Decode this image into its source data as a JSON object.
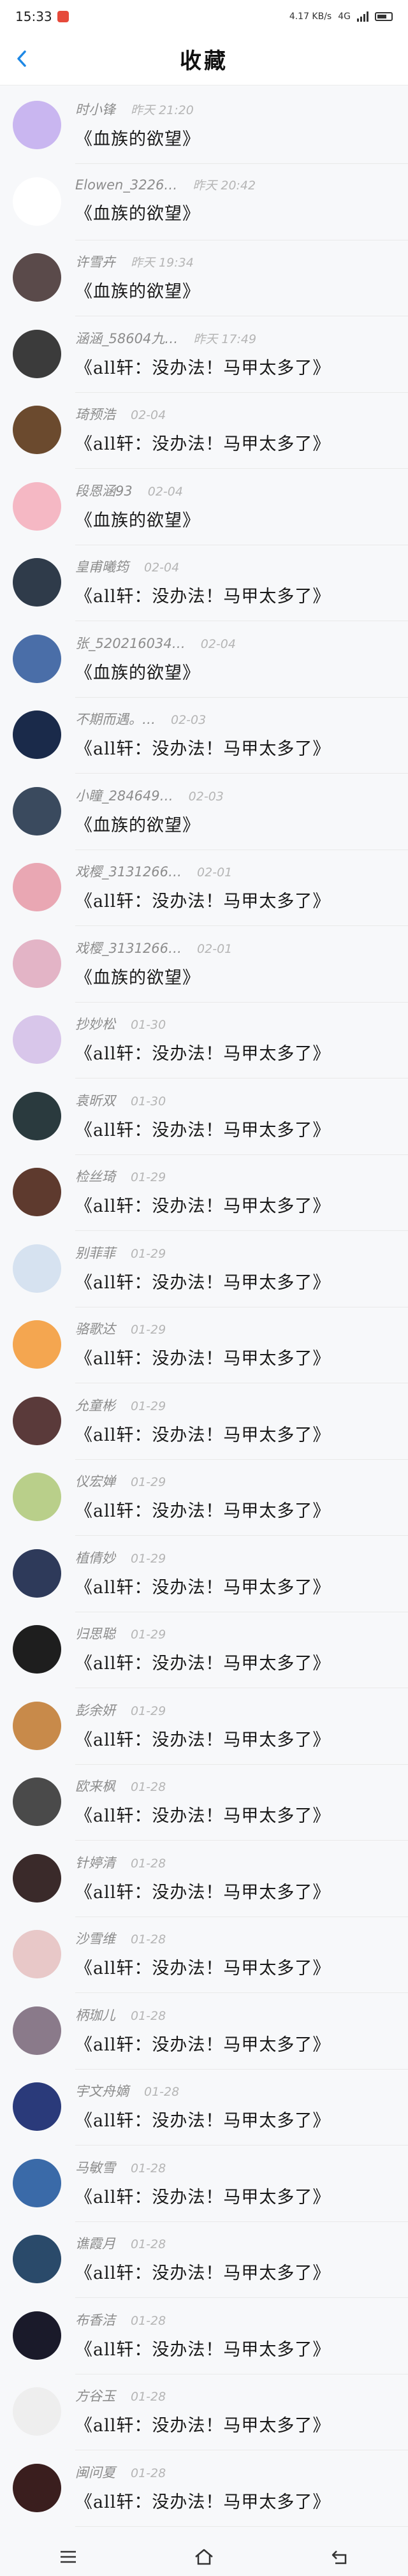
{
  "status": {
    "time": "15:33",
    "signal_text": "4.17 KB/s",
    "network": "4G"
  },
  "page": {
    "title": "收藏"
  },
  "items": [
    {
      "name": "时小锋",
      "time": "昨天 21:20",
      "title": "《血族的欲望》",
      "avatar_color": "#c9b6f0"
    },
    {
      "name": "Elowen_3226…",
      "time": "昨天 20:42",
      "title": "《血族的欲望》",
      "avatar_color": "#ffffff"
    },
    {
      "name": "许雪卉",
      "time": "昨天 19:34",
      "title": "《血族的欲望》",
      "avatar_color": "#5a4a4a"
    },
    {
      "name": "涵涵_58604九…",
      "time": "昨天 17:49",
      "title": "《all轩：没办法！马甲太多了》",
      "avatar_color": "#3b3b3b"
    },
    {
      "name": "琦预浩",
      "time": "02-04",
      "title": "《all轩：没办法！马甲太多了》",
      "avatar_color": "#6b4a2e"
    },
    {
      "name": "段恩涵93",
      "time": "02-04",
      "title": "《血族的欲望》",
      "avatar_color": "#f5b8c4"
    },
    {
      "name": "皇甫曦筠",
      "time": "02-04",
      "title": "《all轩：没办法！马甲太多了》",
      "avatar_color": "#2f3b4a"
    },
    {
      "name": "张_520216034…",
      "time": "02-04",
      "title": "《血族的欲望》",
      "avatar_color": "#4a6ea8"
    },
    {
      "name": "不期而遇。…",
      "time": "02-03",
      "title": "《all轩：没办法！马甲太多了》",
      "avatar_color": "#1a2a4a"
    },
    {
      "name": "小瞳_284649…",
      "time": "02-03",
      "title": "《血族的欲望》",
      "avatar_color": "#3a4a5e"
    },
    {
      "name": "戏樱_3131266…",
      "time": "02-01",
      "title": "《all轩：没办法！马甲太多了》",
      "avatar_color": "#e9a7b3"
    },
    {
      "name": "戏樱_3131266…",
      "time": "02-01",
      "title": "《血族的欲望》",
      "avatar_color": "#e3b4c6"
    },
    {
      "name": "抄妙松",
      "time": "01-30",
      "title": "《all轩：没办法！马甲太多了》",
      "avatar_color": "#d8c6ea"
    },
    {
      "name": "袁昕双",
      "time": "01-30",
      "title": "《all轩：没办法！马甲太多了》",
      "avatar_color": "#2a3a3e"
    },
    {
      "name": "检丝琦",
      "time": "01-29",
      "title": "《all轩：没办法！马甲太多了》",
      "avatar_color": "#5e3a2e"
    },
    {
      "name": "别菲菲",
      "time": "01-29",
      "title": "《all轩：没办法！马甲太多了》",
      "avatar_color": "#d6e2f0"
    },
    {
      "name": "骆歌达",
      "time": "01-29",
      "title": "《all轩：没办法！马甲太多了》",
      "avatar_color": "#f4a650"
    },
    {
      "name": "允童彬",
      "time": "01-29",
      "title": "《all轩：没办法！马甲太多了》",
      "avatar_color": "#5a3a3a"
    },
    {
      "name": "仪宏婵",
      "time": "01-29",
      "title": "《all轩：没办法！马甲太多了》",
      "avatar_color": "#b9cf8a"
    },
    {
      "name": "植倩妙",
      "time": "01-29",
      "title": "《all轩：没办法！马甲太多了》",
      "avatar_color": "#2e3a5a"
    },
    {
      "name": "归思聪",
      "time": "01-29",
      "title": "《all轩：没办法！马甲太多了》",
      "avatar_color": "#1e1e1e"
    },
    {
      "name": "彭余妍",
      "time": "01-29",
      "title": "《all轩：没办法！马甲太多了》",
      "avatar_color": "#c88a4a"
    },
    {
      "name": "欧来枫",
      "time": "01-28",
      "title": "《all轩：没办法！马甲太多了》",
      "avatar_color": "#4a4a4a"
    },
    {
      "name": "针婷清",
      "time": "01-28",
      "title": "《all轩：没办法！马甲太多了》",
      "avatar_color": "#3a2a2a"
    },
    {
      "name": "沙雪维",
      "time": "01-28",
      "title": "《all轩：没办法！马甲太多了》",
      "avatar_color": "#e8c8c8"
    },
    {
      "name": "柄珈儿",
      "time": "01-28",
      "title": "《all轩：没办法！马甲太多了》",
      "avatar_color": "#8a7a8a"
    },
    {
      "name": "宇文舟嫡",
      "time": "01-28",
      "title": "《all轩：没办法！马甲太多了》",
      "avatar_color": "#2a3a7a"
    },
    {
      "name": "马敏雪",
      "time": "01-28",
      "title": "《all轩：没办法！马甲太多了》",
      "avatar_color": "#3a6aa8"
    },
    {
      "name": "谯霞月",
      "time": "01-28",
      "title": "《all轩：没办法！马甲太多了》",
      "avatar_color": "#2a4a6a"
    },
    {
      "name": "布香洁",
      "time": "01-28",
      "title": "《all轩：没办法！马甲太多了》",
      "avatar_color": "#1a1a2a"
    },
    {
      "name": "方谷玉",
      "time": "01-28",
      "title": "《all轩：没办法！马甲太多了》",
      "avatar_color": "#eeeeee"
    },
    {
      "name": "闽问夏",
      "time": "01-28",
      "title": "《all轩：没办法！马甲太多了》",
      "avatar_color": "#3a1e1e"
    }
  ],
  "colors": {
    "accent": "#1e88e5",
    "background": "#f7f8fa"
  }
}
